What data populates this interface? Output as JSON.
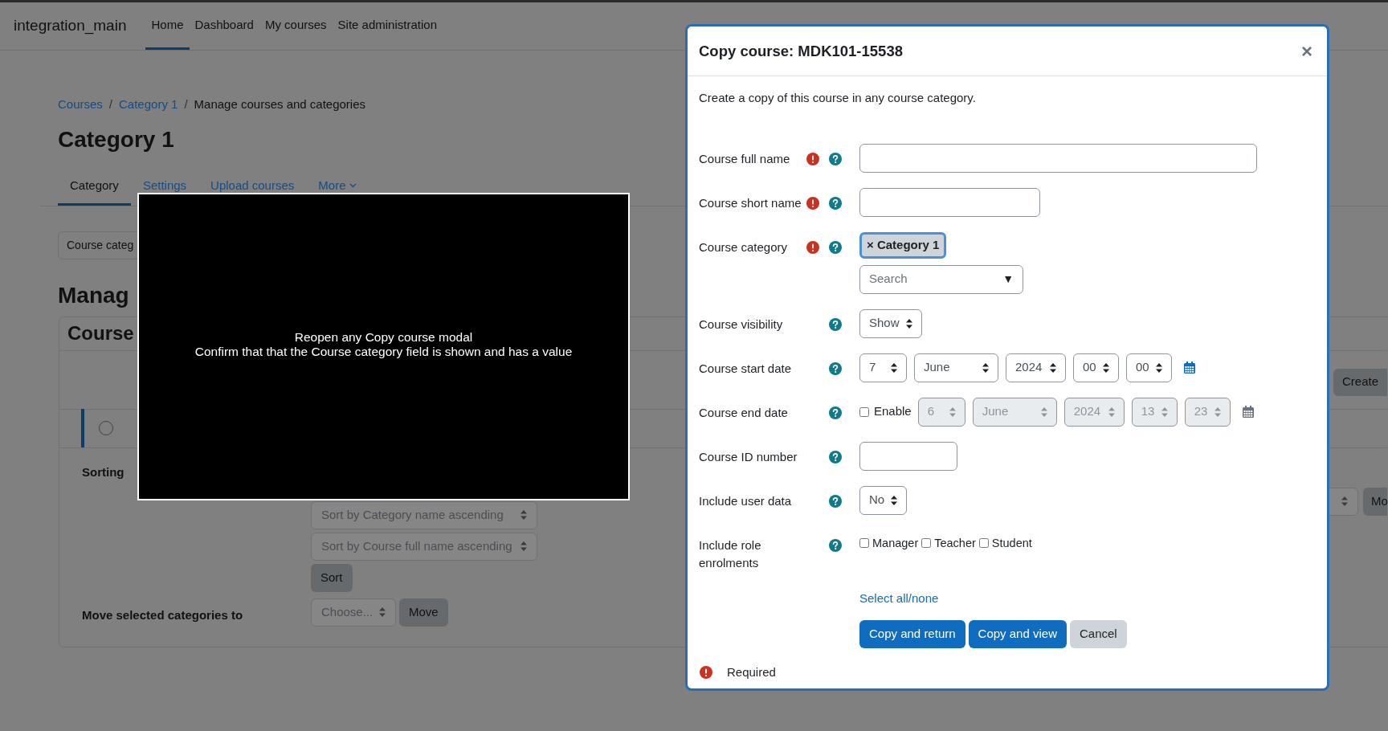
{
  "navbar": {
    "brand": "integration_main",
    "items": [
      {
        "label": "Home",
        "selected": true
      },
      {
        "label": "Dashboard",
        "selected": false
      },
      {
        "label": "My courses",
        "selected": false
      },
      {
        "label": "Site administration",
        "selected": false
      }
    ]
  },
  "breadcrumb": [
    {
      "label": "Courses",
      "link": true
    },
    {
      "separator": "/",
      "label": "Category 1",
      "link": true
    },
    {
      "separator": "/",
      "label": "Manage courses and categories",
      "link": false
    }
  ],
  "page_title": "Category 1",
  "tabs": [
    {
      "label": "Category",
      "selected": true,
      "menu": false
    },
    {
      "label": "Settings",
      "selected": false,
      "menu": false
    },
    {
      "label": "Upload courses",
      "selected": false,
      "menu": false
    },
    {
      "label": "More",
      "selected": false,
      "menu": true
    }
  ],
  "category_select": {
    "value": "Course categ"
  },
  "section_heading": "Manag",
  "card": {
    "heading": "Course",
    "create_button": "Create",
    "row_checked": false,
    "sorting": {
      "label": "Sorting",
      "selects": [
        "Sort by Category name ascending",
        "Sort by Course full name ascending"
      ],
      "button": "Sort"
    },
    "move": {
      "label": "Move selected categories to",
      "placeholder": "Choose...",
      "button": "Move"
    },
    "right_button": "Mo"
  },
  "overlay_message": [
    "Reopen any Copy course modal",
    "Confirm that that the Course category field is shown and has a value"
  ],
  "modal": {
    "title": "Copy course: MDK101-15538",
    "close": "×",
    "description": "Create a copy of this course in any course category.",
    "fields": [
      {
        "kind": "text",
        "label": "Course full name",
        "required": true
      },
      {
        "kind": "text",
        "label": "Course short name",
        "required": true
      },
      {
        "kind": "autocomplete",
        "label": "Course category",
        "required": true,
        "chip": {
          "remove": "×",
          "label": "Category 1"
        },
        "placeholder": "Search",
        "dropdown_mark": "▼"
      },
      {
        "kind": "select",
        "label": "Course visibility",
        "required": false,
        "value": "Show"
      },
      {
        "kind": "date",
        "label": "Course start date",
        "required": false,
        "disabled": false,
        "parts": [
          "7",
          "June",
          "2024",
          "00",
          "00"
        ]
      },
      {
        "kind": "date",
        "label": "Course end date",
        "required": false,
        "disabled": true,
        "enable": {
          "label": "Enable",
          "checked": false
        },
        "parts": [
          "6",
          "June",
          "2024",
          "13",
          "23"
        ]
      },
      {
        "kind": "text",
        "label": "Course ID number",
        "required": false
      },
      {
        "kind": "select",
        "label": "Include user data",
        "required": false,
        "value": "No"
      },
      {
        "kind": "checkboxes",
        "label": "Include role enrolments",
        "required": false,
        "options": [
          {
            "label": "Manager",
            "checked": false
          },
          {
            "label": "Teacher",
            "checked": false
          },
          {
            "label": "Student",
            "checked": false
          }
        ]
      }
    ],
    "select_all_link": "Select all/none",
    "buttons": [
      {
        "label": "Copy and return",
        "kind": "primary"
      },
      {
        "label": "Copy and view",
        "kind": "primary"
      },
      {
        "label": "Cancel",
        "kind": "secondary"
      }
    ],
    "required_note": "Required"
  }
}
